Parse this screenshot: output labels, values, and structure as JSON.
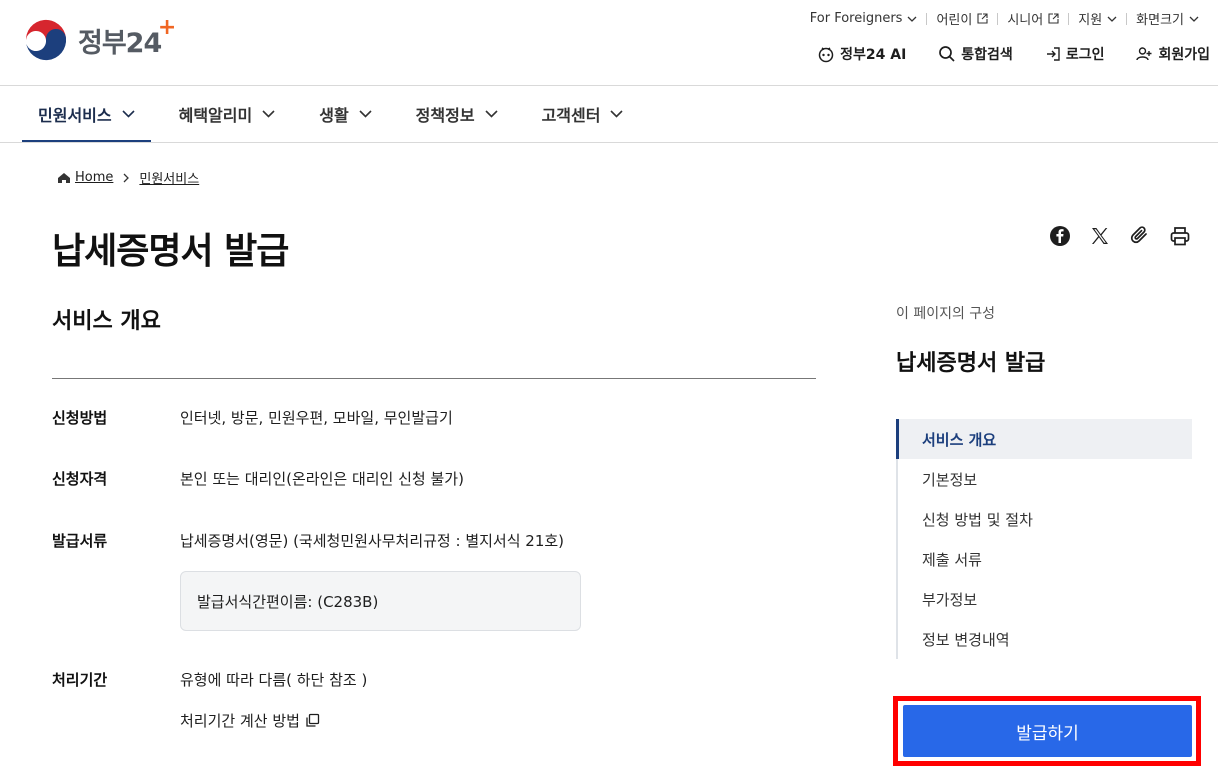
{
  "header": {
    "logo_text": "정부24",
    "logo_plus": "+",
    "util_links": [
      {
        "label": "For Foreigners",
        "icon": "chevron-down-icon"
      },
      {
        "label": "어린이",
        "icon": "external-link-icon"
      },
      {
        "label": "시니어",
        "icon": "external-link-icon"
      },
      {
        "label": "지원",
        "icon": "chevron-down-icon"
      },
      {
        "label": "화면크기",
        "icon": "chevron-down-icon"
      }
    ],
    "actions": [
      {
        "label": "정부24 AI",
        "icon": "ai-robot-icon"
      },
      {
        "label": "통합검색",
        "icon": "search-icon"
      },
      {
        "label": "로그인",
        "icon": "login-icon"
      },
      {
        "label": "회원가입",
        "icon": "user-add-icon"
      }
    ]
  },
  "nav": {
    "items": [
      {
        "label": "민원서비스",
        "active": true
      },
      {
        "label": "혜택알리미",
        "active": false
      },
      {
        "label": "생활",
        "active": false
      },
      {
        "label": "정책정보",
        "active": false
      },
      {
        "label": "고객센터",
        "active": false
      }
    ]
  },
  "breadcrumb": [
    "Home",
    "민원서비스"
  ],
  "page": {
    "title": "납세증명서 발급",
    "share_icons": [
      "facebook-icon",
      "x-icon",
      "paperclip-icon",
      "print-icon"
    ]
  },
  "content": {
    "section_title": "서비스 개요",
    "rows": [
      {
        "label": "신청방법",
        "value": "인터넷, 방문, 민원우편, 모바일, 무인발급기"
      },
      {
        "label": "신청자격",
        "value": "본인 또는 대리인(온라인은 대리인 신청 불가)"
      },
      {
        "label": "발급서류",
        "value": "납세증명서(영문) (국세청민원사무처리규정 : 별지서식 21호)"
      },
      {
        "label": "처리기간",
        "value": "유형에 따라 다름( 하단 참조 )"
      }
    ],
    "note": "발급서식간편이름: (C283B)",
    "calc_link": "처리기간 계산 방법"
  },
  "toc": {
    "caption": "이 페이지의 구성",
    "title": "납세증명서 발급",
    "items": [
      {
        "label": "서비스 개요",
        "active": true
      },
      {
        "label": "기본정보",
        "active": false
      },
      {
        "label": "신청 방법 및 절차",
        "active": false
      },
      {
        "label": "제출 서류",
        "active": false
      },
      {
        "label": "부가정보",
        "active": false
      },
      {
        "label": "정보 변경내역",
        "active": false
      }
    ]
  },
  "cta": {
    "label": "발급하기"
  },
  "colors": {
    "accent": "#2868e8",
    "navy": "#1c3f7d",
    "highlight_frame": "#ff0000",
    "logo_orange": "#f06623"
  }
}
